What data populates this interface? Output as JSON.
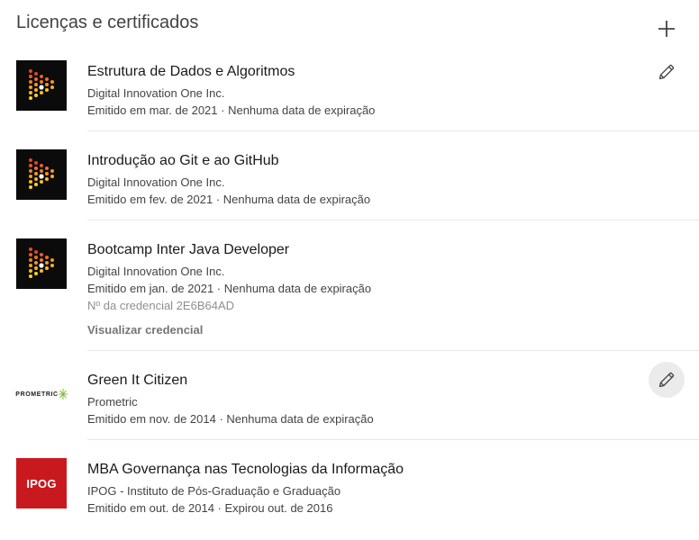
{
  "section": {
    "title": "Licenças e certificados"
  },
  "items": [
    {
      "title": "Estrutura de Dados e Algoritmos",
      "issuer": "Digital Innovation One Inc.",
      "issued": "Emitido em mar. de 2021 · Nenhuma data de expiração",
      "logo_icon": "dio-logo"
    },
    {
      "title": "Introdução ao Git e ao GitHub",
      "issuer": "Digital Innovation One Inc.",
      "issued": "Emitido em fev. de 2021 · Nenhuma data de expiração",
      "logo_icon": "dio-logo"
    },
    {
      "title": "Bootcamp Inter Java Developer",
      "issuer": "Digital Innovation One Inc.",
      "issued": "Emitido em jan. de 2021 · Nenhuma data de expiração",
      "credential_id": "Nº da credencial 2E6B64AD",
      "view_credential": "Visualizar credencial",
      "logo_icon": "dio-logo"
    },
    {
      "title": "Green It Citizen",
      "issuer": "Prometric",
      "issued": "Emitido em nov. de 2014 · Nenhuma data de expiração",
      "logo_text": "PROMETRIC",
      "logo_icon": "prometric-logo"
    },
    {
      "title": "MBA Governança nas Tecnologias da Informação",
      "issuer": "IPOG - Instituto de Pós-Graduação e Graduação",
      "issued": "Emitido em out. de 2014 · Expirou out. de 2016",
      "logo_text": "IPOG",
      "logo_icon": "ipog-logo"
    }
  ],
  "icons": {
    "add": "plus-icon",
    "edit": "pencil-icon"
  },
  "colors": {
    "ipog_red": "#c8191f",
    "dio_bg": "#0b0b0b",
    "divider": "#e6e6e6",
    "hover_bg": "#ebebeb"
  }
}
